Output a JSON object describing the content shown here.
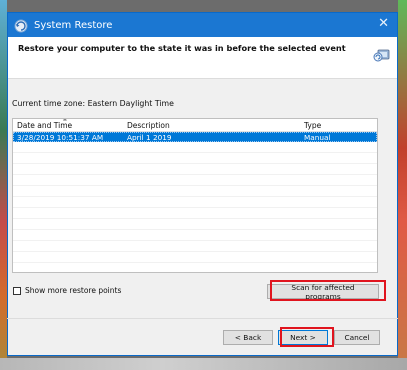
{
  "window": {
    "title": "System Restore"
  },
  "header": {
    "instruction": "Restore your computer to the state it was in before the selected event"
  },
  "timezone": {
    "label": "Current time zone: Eastern Daylight Time"
  },
  "list": {
    "columns": [
      "Date and Time",
      "Description",
      "Type"
    ],
    "rows": [
      {
        "date": "3/28/2019 10:51:37 AM",
        "description": "April 1 2019",
        "type": "Manual",
        "selected": true
      }
    ]
  },
  "options": {
    "show_more_label": "Show more restore points"
  },
  "buttons": {
    "scan": "Scan for affected programs",
    "back": "< Back",
    "next": "Next >",
    "cancel": "Cancel"
  },
  "colors": {
    "titlebar": "#1b77d2",
    "selection": "#0078d7",
    "highlight": "#e0141e"
  },
  "icons": {
    "title": "system-restore-icon",
    "header": "system-restore-icon",
    "close": "close-icon"
  }
}
